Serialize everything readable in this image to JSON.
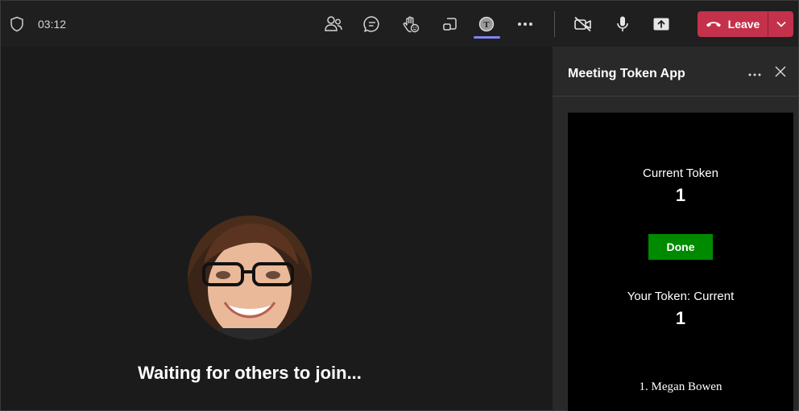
{
  "topbar": {
    "timer": "03:12",
    "icons": {
      "shield": "shield-icon",
      "people": "people-icon",
      "chat": "chat-icon",
      "reactions": "raise-hand-icon",
      "rooms": "share-tray-icon",
      "app": "meeting-token-app-icon",
      "more": "more-options-icon",
      "camera": "camera-off-icon",
      "mic": "microphone-icon",
      "share": "share-screen-icon"
    },
    "app_badge_letter": "T",
    "leave": {
      "label": "Leave",
      "color": "#c4314b"
    }
  },
  "stage": {
    "waiting_text": "Waiting for others to join..."
  },
  "panel": {
    "title": "Meeting Token App",
    "app": {
      "current_token_label": "Current Token",
      "current_token_value": "1",
      "done_label": "Done",
      "done_color": "#008a00",
      "your_token_label": "Your Token: Current",
      "your_token_value": "1",
      "queue": [
        "1. Megan Bowen"
      ]
    }
  },
  "colors": {
    "background": "#1f1f1f",
    "stage": "#1b1b1b",
    "panel": "#292929",
    "accent": "#7f85f5"
  }
}
